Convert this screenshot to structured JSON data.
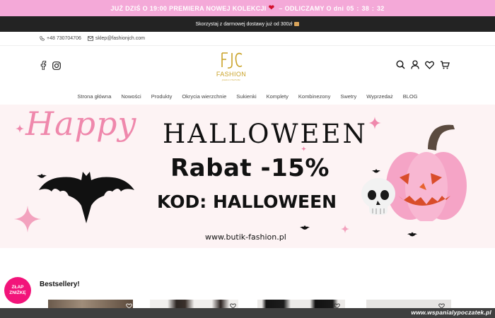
{
  "promo": {
    "text_before": "JUŻ DZIŚ O 19:00 PREMIERA NOWEJ KOLEKCJI",
    "heart_icon": "heart-icon",
    "text_after": "ODLICZAMY O",
    "countdown": "dni  05 : 38 : 32",
    "bg_color": "#f4a9d8"
  },
  "shipping": {
    "text": "Skorzystaj z darmowej dostawy już od 300zł"
  },
  "contact": {
    "phone": "+48 730704706",
    "email": "sklep@fashionjch.com"
  },
  "logo": {
    "monogram": "FJC",
    "name": "FASHION",
    "tagline": "Jessica Charlotte",
    "color": "#c9a227"
  },
  "nav": {
    "items": [
      "Strona główna",
      "Nowości",
      "Produkty",
      "Okrycia wierzchnie",
      "Sukienki",
      "Komplety",
      "Kombinezony",
      "Swetry",
      "Wyprzedaż",
      "BLOG"
    ]
  },
  "banner": {
    "happy": "Happy",
    "title": "HALLOWEEN",
    "discount": "Rabat -15%",
    "code": "KOD: HALLOWEEN",
    "url": "www.butik-fashion.pl",
    "bg_color": "#fdf3f4",
    "accent_color": "#ef88ac"
  },
  "bestsellers": {
    "title": "Bestsellery!"
  },
  "badge": {
    "line1": "ZŁAP",
    "line2": "ZNIŻKĘ",
    "color": "#f2147a"
  },
  "watermark": {
    "text": "www.wspanialypoczatek.pl"
  }
}
